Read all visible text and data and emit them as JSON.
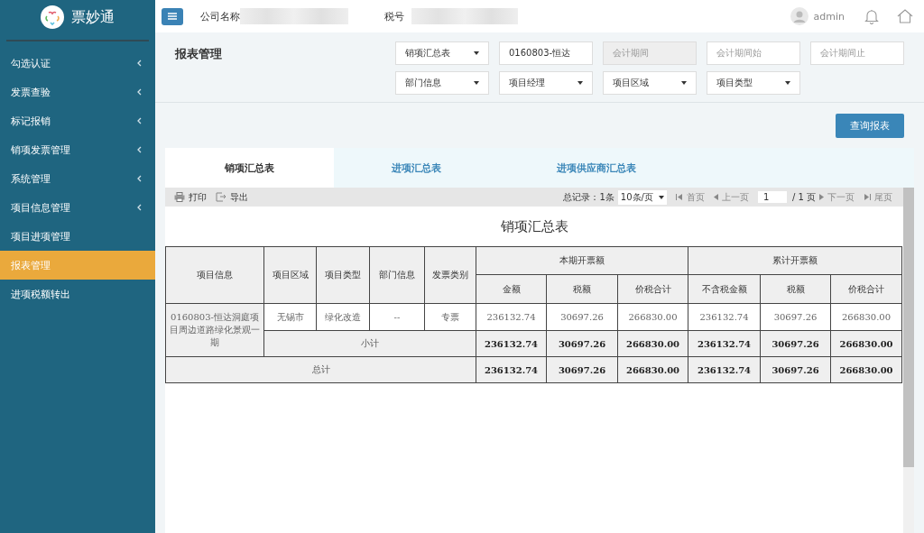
{
  "sidebar": {
    "logo_text": "票妙通",
    "items": [
      {
        "label": "勾选认证",
        "has_arrow": true,
        "selected": false
      },
      {
        "label": "发票查验",
        "has_arrow": true,
        "selected": false
      },
      {
        "label": "标记报销",
        "has_arrow": true,
        "selected": false
      },
      {
        "label": "销项发票管理",
        "has_arrow": true,
        "selected": false
      },
      {
        "label": "系统管理",
        "has_arrow": true,
        "selected": false
      },
      {
        "label": "项目信息管理",
        "has_arrow": true,
        "selected": false
      },
      {
        "label": "项目进项管理",
        "has_arrow": false,
        "selected": false
      },
      {
        "label": "报表管理",
        "has_arrow": false,
        "selected": true
      },
      {
        "label": "进项税额转出",
        "has_arrow": false,
        "selected": false
      }
    ]
  },
  "header": {
    "company_label": "公司名称",
    "tax_label": "税号",
    "user": "admin"
  },
  "page_title": "报表管理",
  "filters": [
    {
      "kind": "select",
      "value": "销项汇总表"
    },
    {
      "kind": "input",
      "value": "0160803-恒达"
    },
    {
      "kind": "disabled",
      "placeholder": "会计期间"
    },
    {
      "kind": "input",
      "placeholder": "会计期间始"
    },
    {
      "kind": "input",
      "placeholder": "会计期间止"
    },
    {
      "kind": "select",
      "value": "部门信息"
    },
    {
      "kind": "select",
      "value": "项目经理"
    },
    {
      "kind": "select",
      "value": "项目区域"
    },
    {
      "kind": "select",
      "value": "项目类型"
    }
  ],
  "query_button": "查询报表",
  "tabs": [
    {
      "label": "销项汇总表",
      "selected": true
    },
    {
      "label": "进项汇总表",
      "selected": false
    },
    {
      "label": "进项供应商汇总表",
      "selected": false
    }
  ],
  "toolbar": {
    "print": "打印",
    "export": "导出",
    "total_records": "总记录：1条",
    "page_size": "10条/页",
    "first": "首页",
    "prev": "上一页",
    "page": "1",
    "page_total": "/ 1 页",
    "next": "下一页",
    "last": "尾页"
  },
  "report": {
    "title": "销项汇总表",
    "dim_columns": [
      "项目信息",
      "项目区域",
      "项目类型",
      "部门信息",
      "发票类别"
    ],
    "groups": [
      {
        "label": "本期开票额",
        "columns": [
          "金额",
          "税额",
          "价税合计"
        ]
      },
      {
        "label": "累计开票额",
        "columns": [
          "不含税金额",
          "税额",
          "价税合计"
        ]
      }
    ],
    "rows": [
      {
        "kind": "detail",
        "project": "0160803-恒达洞庭项目周边道路绿化景观一期",
        "dims": [
          "无锡市",
          "绿化改造",
          "--",
          "专票"
        ],
        "values": [
          "236132.74",
          "30697.26",
          "266830.00",
          "236132.74",
          "30697.26",
          "266830.00"
        ]
      },
      {
        "kind": "subtotal",
        "label": "小计",
        "values": [
          "236132.74",
          "30697.26",
          "266830.00",
          "236132.74",
          "30697.26",
          "266830.00"
        ]
      },
      {
        "kind": "total",
        "label": "总计",
        "values": [
          "236132.74",
          "30697.26",
          "266830.00",
          "236132.74",
          "30697.26",
          "266830.00"
        ]
      }
    ]
  }
}
